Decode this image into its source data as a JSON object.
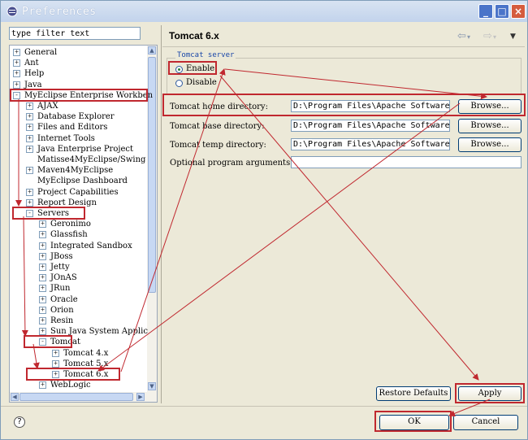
{
  "window": {
    "title": "Preferences"
  },
  "filter": {
    "value": "type filter text"
  },
  "tree": {
    "top": [
      {
        "label": "General",
        "state": "+"
      },
      {
        "label": "Ant",
        "state": "+"
      },
      {
        "label": "Help",
        "state": "+"
      },
      {
        "label": "Java",
        "state": "+"
      },
      {
        "label": "MyEclipse Enterprise Workben",
        "state": "-"
      }
    ],
    "myeclipse": [
      {
        "label": "AJAX",
        "state": "+"
      },
      {
        "label": "Database Explorer",
        "state": "+"
      },
      {
        "label": "Files and Editors",
        "state": "+"
      },
      {
        "label": "Internet Tools",
        "state": "+"
      },
      {
        "label": "Java Enterprise Project",
        "state": "+"
      },
      {
        "label": "Matisse4MyEclipse/Swing",
        "state": ""
      },
      {
        "label": "Maven4MyEclipse",
        "state": "+"
      },
      {
        "label": "MyEclipse Dashboard",
        "state": ""
      },
      {
        "label": "Project Capabilities",
        "state": "+"
      },
      {
        "label": "Report Design",
        "state": "+"
      },
      {
        "label": "Servers",
        "state": "-"
      }
    ],
    "servers": [
      {
        "label": "Geronimo",
        "state": "+"
      },
      {
        "label": "Glassfish",
        "state": "+"
      },
      {
        "label": "Integrated Sandbox",
        "state": "+"
      },
      {
        "label": "JBoss",
        "state": "+"
      },
      {
        "label": "Jetty",
        "state": "+"
      },
      {
        "label": "JOnAS",
        "state": "+"
      },
      {
        "label": "JRun",
        "state": "+"
      },
      {
        "label": "Oracle",
        "state": "+"
      },
      {
        "label": "Orion",
        "state": "+"
      },
      {
        "label": "Resin",
        "state": "+"
      },
      {
        "label": "Sun Java System Applic",
        "state": "+"
      },
      {
        "label": "Tomcat",
        "state": "-"
      }
    ],
    "tomcat": [
      {
        "label": "Tomcat  4.x",
        "state": "+"
      },
      {
        "label": "Tomcat  5.x",
        "state": "+"
      },
      {
        "label": "Tomcat  6.x",
        "state": "+"
      }
    ],
    "after": [
      {
        "label": "WebLogic",
        "state": "+"
      }
    ]
  },
  "page": {
    "title": "Tomcat  6.x",
    "group_label": "Tomcat server",
    "enable_label": "Enable",
    "disable_label": "Disable",
    "enabled": true,
    "home_label": "Tomcat home directory:",
    "home_value": "D:\\Program Files\\Apache Software Fou",
    "base_label": "Tomcat base directory:",
    "base_value": "D:\\Program Files\\Apache Software Fou",
    "temp_label": "Tomcat temp directory:",
    "temp_value": "D:\\Program Files\\Apache Software Fou",
    "args_label": "Optional program arguments:",
    "args_value": "",
    "browse_label": "Browse...",
    "restore_label": "Restore Defaults",
    "apply_label": "Apply"
  },
  "footer": {
    "ok_label": "OK",
    "cancel_label": "Cancel"
  },
  "icons": {
    "back": "back-arrow-icon",
    "forward": "forward-arrow-icon",
    "menu": "dropdown-menu-icon",
    "help": "help-icon"
  },
  "colors": {
    "highlight": "#c0282f",
    "accent": "#1a47a8"
  }
}
